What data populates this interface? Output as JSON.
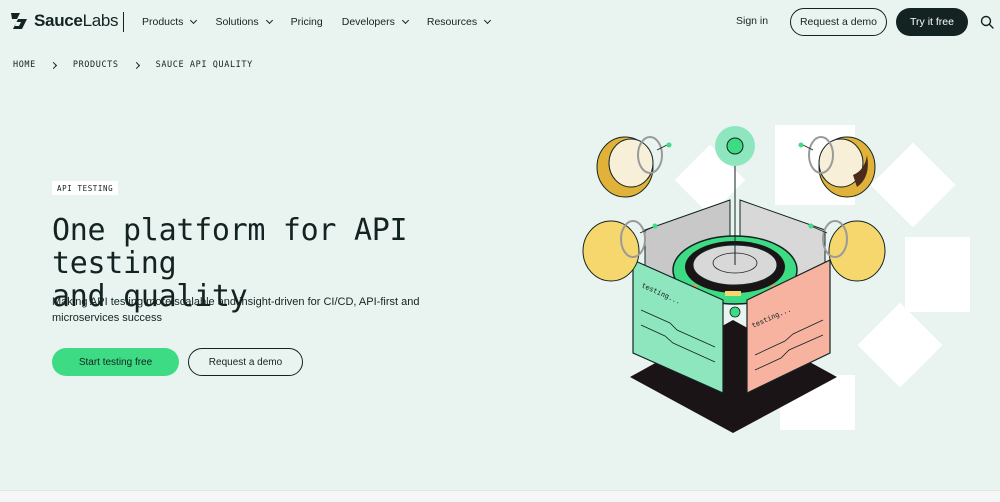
{
  "brand": {
    "name_bold": "Sauce",
    "name_light": "Labs"
  },
  "nav": {
    "items": [
      {
        "label": "Products",
        "has_dropdown": true
      },
      {
        "label": "Solutions",
        "has_dropdown": true
      },
      {
        "label": "Pricing",
        "has_dropdown": false
      },
      {
        "label": "Developers",
        "has_dropdown": true
      },
      {
        "label": "Resources",
        "has_dropdown": true
      }
    ],
    "signin_label": "Sign in",
    "demo_label": "Request a demo",
    "try_label": "Try it free",
    "search_icon": "search-icon"
  },
  "breadcrumb": [
    "HOME",
    "PRODUCTS",
    "SAUCE API QUALITY"
  ],
  "hero": {
    "badge": "API TESTING",
    "title_line1": "One platform for API testing",
    "title_line2": "and quality",
    "subtitle_line1": "Making API testing more scalable and insight-driven for CI/CD, API-first and",
    "subtitle_line2": "microservices success",
    "primary_cta": "Start testing free",
    "secondary_cta": "Request a demo"
  },
  "illustration": {
    "panel_left_text": "testing...",
    "panel_right_text": "testing..."
  },
  "colors": {
    "background": "#e9f4f1",
    "dark": "#132322",
    "accent_green": "#3ddc84",
    "panel_green": "#8ee6bf",
    "panel_salmon": "#f7b3a0",
    "egg_yellow": "#f5d76e"
  }
}
